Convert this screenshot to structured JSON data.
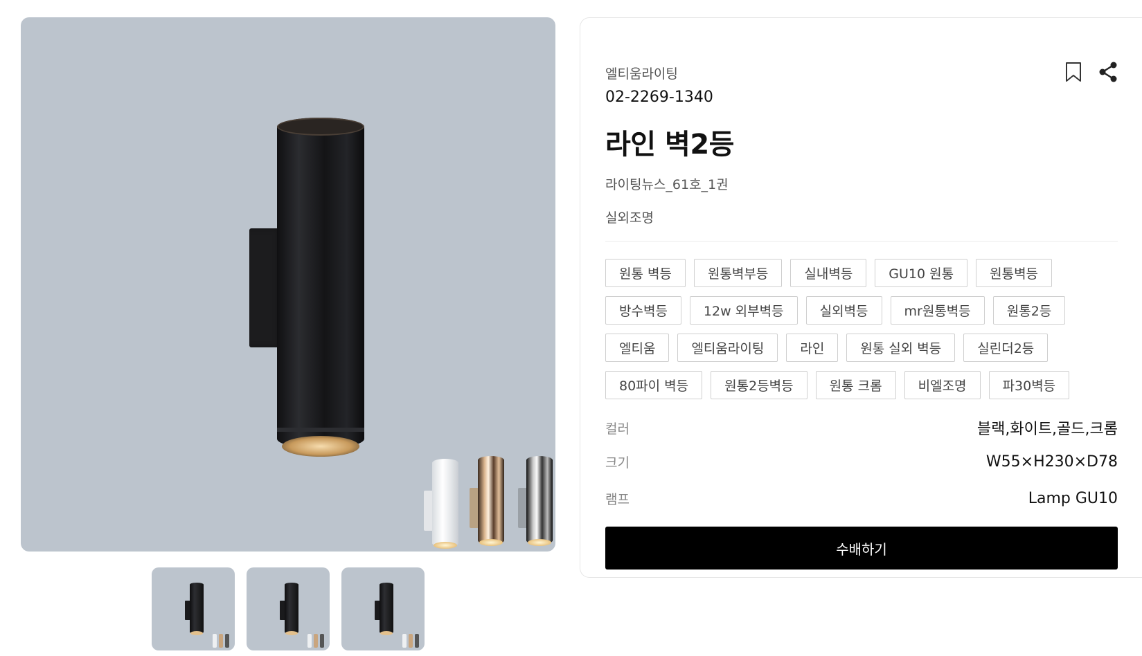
{
  "product": {
    "brand": "엘티움라이팅",
    "phone": "02-2269-1340",
    "title": "라인 벽2등",
    "issue": "라이팅뉴스_61호_1권",
    "category": "실외조명"
  },
  "tags": [
    "원통 벽등",
    "원통벽부등",
    "실내벽등",
    "GU10 원통",
    "원통벽등",
    "방수벽등",
    "12w 외부벽등",
    "실외벽등",
    "mr원통벽등",
    "원통2등",
    "엘티움",
    "엘티움라이팅",
    "라인",
    "원통 실외 벽등",
    "실린더2등",
    "80파이 벽등",
    "원통2등벽등",
    "원통 크롬",
    "비엘조명",
    "파30벽등"
  ],
  "specs": {
    "color": {
      "label": "컬러",
      "value": "블랙,화이트,골드,크롬"
    },
    "size": {
      "label": "크기",
      "value": "W55×H230×D78"
    },
    "lamp": {
      "label": "램프",
      "value": "Lamp GU10"
    }
  },
  "actions": {
    "order_label": "수배하기",
    "bookmark_icon": "bookmark-icon",
    "share_icon": "share-icon"
  },
  "gallery": {
    "thumbnail_count": 3,
    "background": "#bcc4cd"
  },
  "colors": {
    "primary_button": "#000000",
    "image_background": "#bcc4cd"
  }
}
